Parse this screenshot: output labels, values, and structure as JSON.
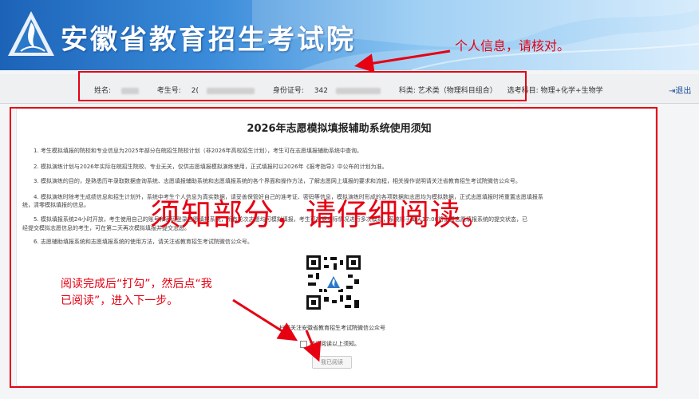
{
  "header": {
    "site_title": "安徽省教育招生考试院"
  },
  "annotations": {
    "top": "个人信息，请核对。",
    "overlay": "须知部分，请仔细阅读。",
    "bottom_line1": "阅读完成后“打勾”，然后点“我",
    "bottom_line2": "已阅读”，进入下一步。"
  },
  "info": {
    "name_label": "姓名:",
    "exam_no_label": "考生号:",
    "exam_no_value": "2(",
    "id_label": "身份证号:",
    "id_value": "342",
    "category": "科类: 艺术类（物理科目组合）",
    "subjects": "选考科目: 物理+化学+生物学"
  },
  "logout_label": "退出",
  "notice": {
    "title": "2026年志愿模拟填报辅助系统使用须知",
    "items": [
      "1. 考生模拟填报的院校和专业信息为2025年部分在皖招生院校计划（非2026年高校招生计划），考生可在志愿填报辅助系统中查询。",
      "2. 模拟演练计划与2026年实际在皖招生院校、专业无关，仅供志愿填报模拟演练使用，正式填报时以2026年《报考指导》中公布的计划为准。",
      "3. 模拟演练的目的，是熟悉历年录取数据查询系统、志愿填报辅助系统和志愿填报系统的各个界面和操作方法，了解志愿网上填报的要求和流程，相关操作说明请关注省教育招生考试院微信公众号。",
      "4. 模拟演练时除考生成绩信息和招生计划外，系统中考生个人信息为真实数据，请妥善保管好自己的准考证、密码等信息，模拟演练时形成的各项数据和志愿均为模拟数据，正式志愿填报时将重置志愿填报系",
      "统，清零模拟填报的信息。",
      "5. 模拟填报系统24小时开放，考生使用自己的账号和密码登录志愿填报系统，所有轮次志愿均可模拟填报，考生可根据实际情况进行多次模拟，系统将于每天17:00将重置志愿填报系统的提交状态，已",
      "经提交模拟志愿信息的考生，可在第二天再次模拟填报并提交志愿。",
      "6. 志愿辅助填报系统和志愿填报系统的使用方法，请关注省教育招生考试院微信公众号。"
    ],
    "qr_caption": "扫码关注安徽省教育招生考试院微信公众号",
    "confirm_label": "我已阅读以上须知。",
    "read_button": "我已阅读"
  },
  "colors": {
    "accent_red": "#e60012",
    "header_blue": "#1c63b8",
    "link_blue": "#1e4f9c"
  },
  "icons": {
    "logo": "flame-triangle-logo",
    "logout": "logout-icon",
    "qr": "qr-code"
  }
}
